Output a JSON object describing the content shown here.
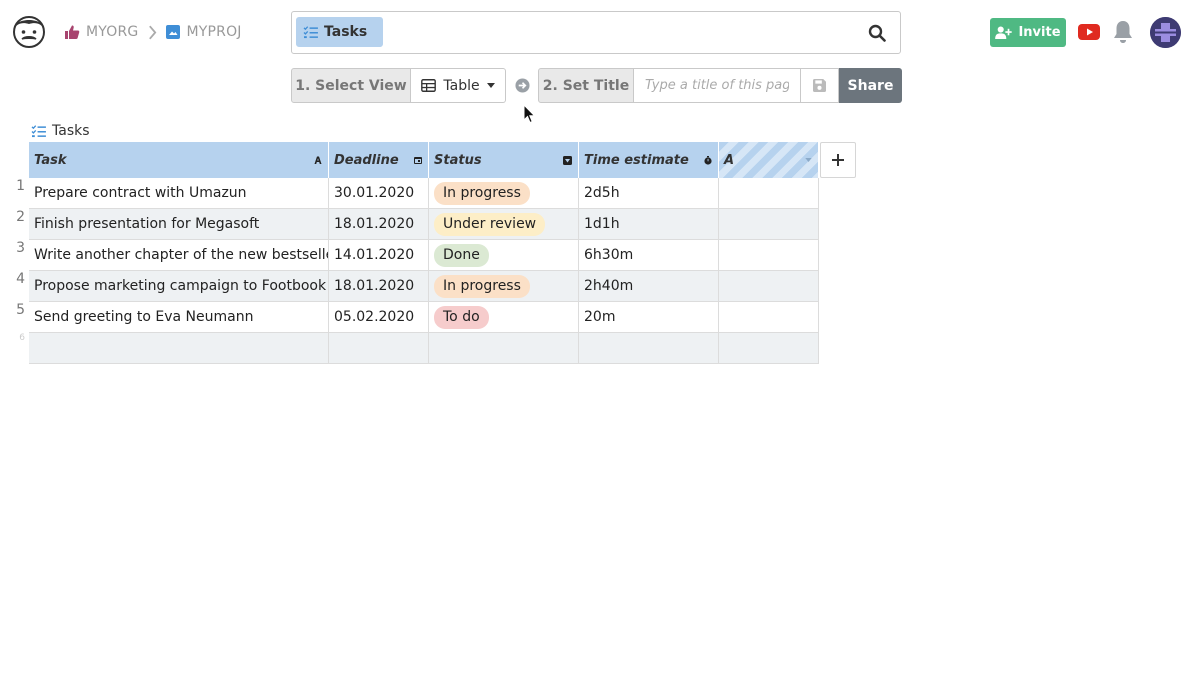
{
  "header": {
    "breadcrumb": [
      {
        "label": "MYORG",
        "icon": "thumbs-up-icon"
      },
      {
        "label": "MYPROJ",
        "icon": "image-icon"
      }
    ],
    "search": {
      "chip_label": "Tasks",
      "chip_icon": "list-check-icon"
    },
    "invite_label": "Invite"
  },
  "toolbar": {
    "step1_label": "1. Select View",
    "view_label": "Table",
    "step2_label": "2. Set Title",
    "title_placeholder": "Type a title of this page",
    "title_value": "",
    "share_label": "Share"
  },
  "table": {
    "title": "Tasks",
    "columns": [
      {
        "label": "Task",
        "type_icon": "text-type-icon"
      },
      {
        "label": "Deadline",
        "type_icon": "calendar-icon"
      },
      {
        "label": "Status",
        "type_icon": "dropdown-select-icon"
      },
      {
        "label": "Time estimate",
        "type_icon": "stopwatch-icon"
      },
      {
        "label": "A",
        "type_icon": "chevron-down-icon"
      }
    ],
    "rows": [
      {
        "num": "1",
        "task": "Prepare contract with Umazun",
        "deadline": "30.01.2020",
        "status": "In progress",
        "time": "2d5h",
        "a": ""
      },
      {
        "num": "2",
        "task": "Finish presentation for Megasoft",
        "deadline": "18.01.2020",
        "status": "Under review",
        "time": "1d1h",
        "a": ""
      },
      {
        "num": "3",
        "task": "Write another chapter of the new bestseller",
        "deadline": "14.01.2020",
        "status": "Done",
        "time": "6h30m",
        "a": ""
      },
      {
        "num": "4",
        "task": "Propose marketing campaign to Footbook",
        "deadline": "18.01.2020",
        "status": "In progress",
        "time": "2h40m",
        "a": ""
      },
      {
        "num": "5",
        "task": "Send greeting to Eva Neumann",
        "deadline": "05.02.2020",
        "status": "To do",
        "time": "20m",
        "a": ""
      },
      {
        "num": "6",
        "task": "",
        "deadline": "",
        "status": "",
        "time": "",
        "a": ""
      }
    ],
    "status_colors": {
      "In progress": "#fbe0c7",
      "Under review": "#fdeec7",
      "Done": "#dbe9d3",
      "To do": "#f6cccc"
    }
  },
  "colors": {
    "header_accent": "#b6d2ee",
    "invite_green": "#4fb983",
    "share_gray": "#6c757d",
    "youtube_red": "#e02a20"
  }
}
